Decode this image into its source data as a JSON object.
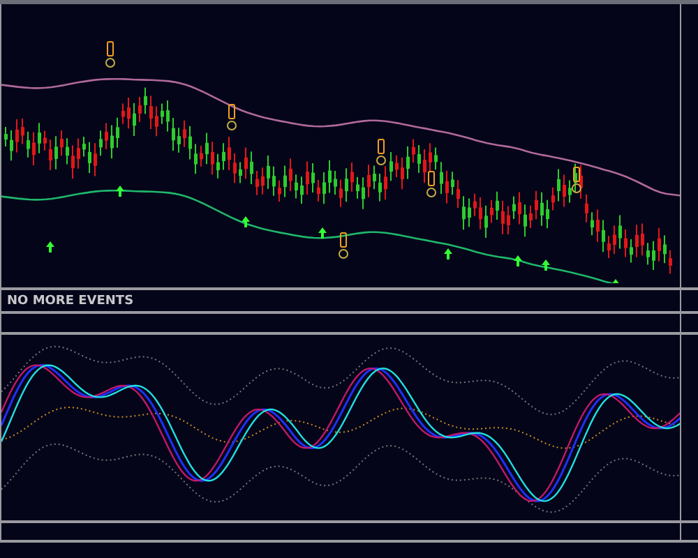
{
  "events_panel": {
    "message": "NO MORE EVENTS"
  }
}
